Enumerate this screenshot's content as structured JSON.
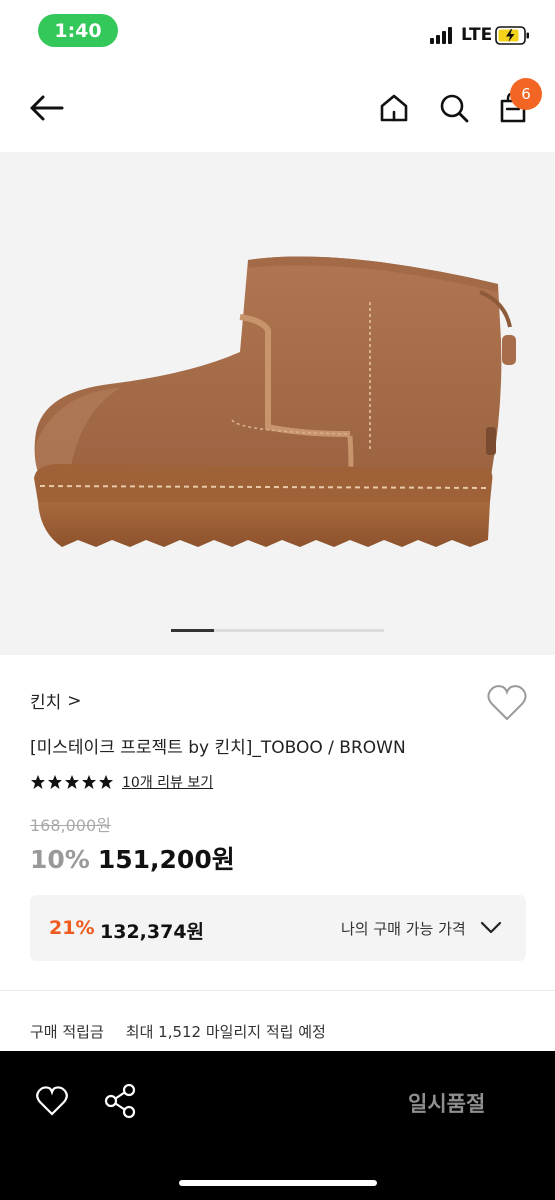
{
  "status_bar": {
    "time": "1:40",
    "network": "LTE"
  },
  "nav": {
    "cart_count": "6",
    "icons": [
      "back-arrow-icon",
      "home-icon",
      "search-icon",
      "cart-icon"
    ]
  },
  "gallery": {
    "image": "brown suede ankle boot",
    "current_slide_fraction": 0.2
  },
  "product": {
    "brand": "킨치",
    "brand_chevron": ">",
    "title": "[미스테이크 프로젝트 by 킨치]_TOBOO / BROWN",
    "rating_stars": 5,
    "review_link": "10개 리뷰 보기",
    "original_price": "168,000원",
    "discount_rate": "10%",
    "sale_price": "151,200원"
  },
  "my_price": {
    "discount_rate": "21%",
    "price": "132,374원",
    "label": "나의 구매 가능 가격"
  },
  "points": {
    "label": "구매 적립금",
    "value": "최대 1,512 마일리지 적립 예정"
  },
  "bottom_bar": {
    "status_button": "일시품절"
  },
  "colors": {
    "accent": "#f26522",
    "status_green": "#34c759",
    "bottom_bar": "#000000",
    "my_price_discount": "#ef5a1f"
  }
}
